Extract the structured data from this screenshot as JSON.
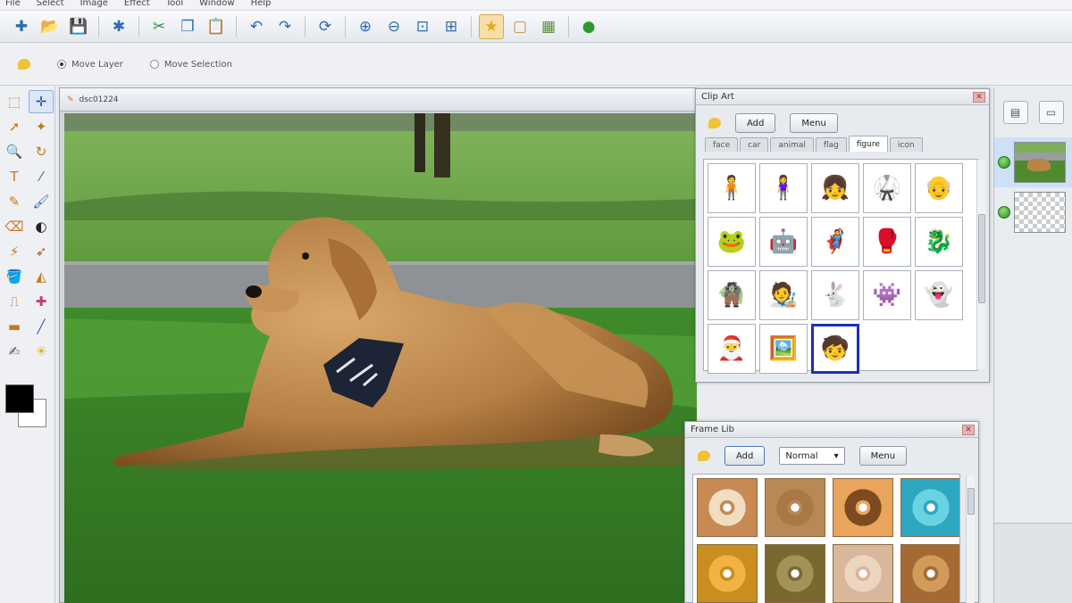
{
  "menu": [
    "File",
    "Select",
    "Image",
    "Effect",
    "Tool",
    "Window",
    "Help"
  ],
  "toolbar": {
    "buttons": [
      "new-icon",
      "open-icon",
      "save-icon",
      "wand-icon",
      "cut-icon",
      "copy-icon",
      "paste-icon",
      "undo-icon",
      "redo-icon",
      "refresh-icon",
      "zoom-in-icon",
      "zoom-out-icon",
      "fit-icon",
      "actual-size-icon",
      "star-icon",
      "frame-icon",
      "picture-icon",
      "go-icon"
    ],
    "active_index": 14
  },
  "options": {
    "move_layer": "Move Layer",
    "move_selection": "Move Selection",
    "selected": "Move Layer"
  },
  "tools": [
    "◻",
    "➤",
    "✥",
    "✎",
    "🔍",
    "◯",
    "✒",
    "⊕",
    "✏",
    "🖌",
    "◐",
    "◑",
    "✂",
    "🪄",
    "✇",
    "✦",
    "⛏",
    "✖",
    "▭",
    "📏",
    "✍",
    "☀"
  ],
  "canvas": {
    "title": "dsc01224"
  },
  "clipart": {
    "title": "Clip Art",
    "add_label": "Add",
    "menu_label": "Menu",
    "tabs": [
      "face",
      "car",
      "animal",
      "flag",
      "figure",
      "icon"
    ],
    "active_tab": "figure",
    "items": [
      "🧍",
      "🧍‍♀️",
      "👧",
      "🥋",
      "👴",
      "🐸",
      "🤖",
      "🦸",
      "🥊",
      "🐉",
      "🧌",
      "🧑‍🎨",
      "🐇",
      "👾",
      "👻",
      "🎅",
      "🖼️",
      "🧒"
    ],
    "selected_index": 17
  },
  "framelib": {
    "title": "Frame Lib",
    "add_label": "Add",
    "mode_value": "Normal",
    "menu_label": "Menu",
    "frames": [
      {
        "outer": "#c88a52",
        "mid": "#f1ddc1",
        "inner": "#fff"
      },
      {
        "outer": "#b78956",
        "mid": "#a97845",
        "inner": "#fff"
      },
      {
        "outer": "#e8a55b",
        "mid": "#7e4a1f",
        "inner": "#fff"
      },
      {
        "outer": "#2ea7c1",
        "mid": "#6ad3e2",
        "inner": "#fff"
      },
      {
        "outer": "#c98d20",
        "mid": "#f1b443",
        "inner": "#fff"
      },
      {
        "outer": "#77692f",
        "mid": "#a3925a",
        "inner": "#fff"
      },
      {
        "outer": "#d8b79b",
        "mid": "#ecd6c0",
        "inner": "#fff"
      },
      {
        "outer": "#a56a33",
        "mid": "#d19b5a",
        "inner": "#fff"
      }
    ]
  },
  "layers": {
    "items": [
      "photo",
      "transparent"
    ],
    "selected_index": 0
  }
}
